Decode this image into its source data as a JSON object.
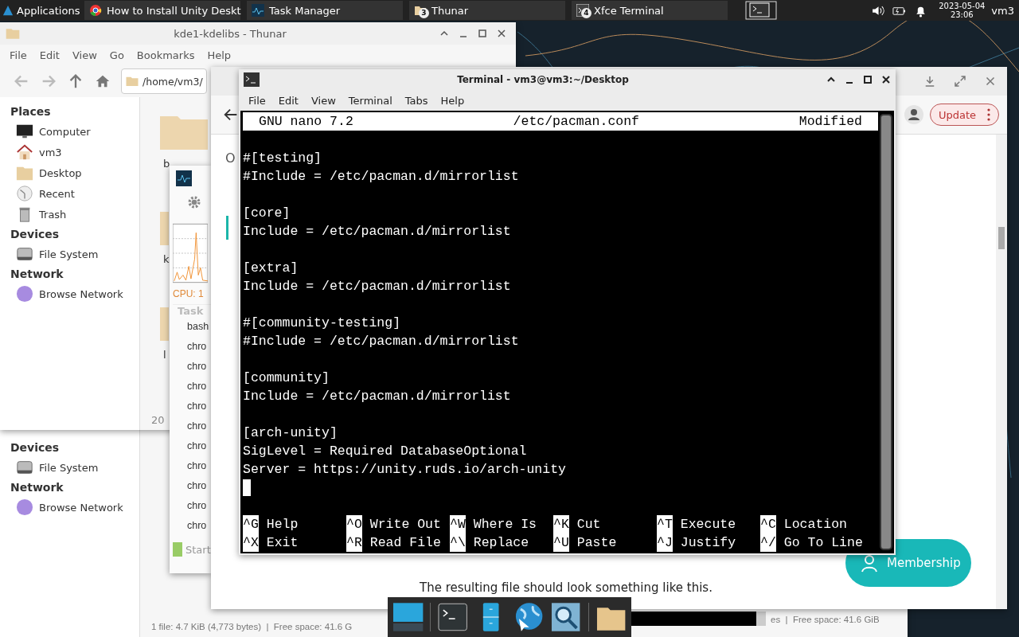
{
  "panel": {
    "apps_label": "Applications",
    "tasks": [
      {
        "kind": "browser",
        "label": "How to Install Unity Deskt"
      },
      {
        "kind": "monitor",
        "label": "Task Manager"
      },
      {
        "kind": "folder",
        "label": "Thunar",
        "badge": "3"
      },
      {
        "kind": "terminal",
        "label": "Xfce Terminal",
        "badge": "4"
      }
    ],
    "date": "2023-05-04",
    "time": "23:06",
    "user": "vm3"
  },
  "thunar_lower": {
    "sidebar": [
      {
        "heading": "Devices",
        "items": [
          {
            "label": "File System"
          }
        ]
      },
      {
        "heading": "Network",
        "items": [
          {
            "label": "Browse Network"
          }
        ]
      }
    ],
    "status": "1 file: 4.7 KiB (4,773 bytes)  |  Free space: 41.6 G"
  },
  "other_status": "es  |  Free space: 41.6 GiB",
  "thunar": {
    "title": "kde1-kdelibs - Thunar",
    "menu": [
      "File",
      "Edit",
      "View",
      "Go",
      "Bookmarks",
      "Help"
    ],
    "path": "/home/vm3/",
    "sidebar": [
      {
        "heading": "Places",
        "items": [
          {
            "label": "Computer"
          },
          {
            "label": "vm3"
          },
          {
            "label": "Desktop"
          },
          {
            "label": "Recent"
          },
          {
            "label": "Trash"
          }
        ]
      },
      {
        "heading": "Devices",
        "items": [
          {
            "label": "File System"
          }
        ]
      },
      {
        "heading": "Network",
        "items": [
          {
            "label": "Browse Network"
          }
        ]
      }
    ],
    "folders": [
      {
        "label": "b"
      },
      {
        "label": "k"
      },
      {
        "label": "l"
      }
    ],
    "status": "20"
  },
  "task_manager": {
    "cpu": "CPU: 1",
    "column": "Task",
    "processes": [
      "bash",
      "chro",
      "chro",
      "chro",
      "chro",
      "chro",
      "chro",
      "chro",
      "chro",
      "chro",
      "chro"
    ],
    "start": "Start"
  },
  "browser": {
    "heading_fragment": "O",
    "update": "Update",
    "membership": "Membership",
    "caption": "The resulting file should look something like this."
  },
  "terminal": {
    "title": "Terminal - vm3@vm3:~/Desktop",
    "menu": [
      "File",
      "Edit",
      "View",
      "Terminal",
      "Tabs",
      "Help"
    ],
    "nano": {
      "version": "GNU nano 7.2",
      "file": "/etc/pacman.conf",
      "status": "Modified",
      "blocks": [
        [
          "#[testing]",
          "#Include = /etc/pacman.d/mirrorlist"
        ],
        [
          "[core]",
          "Include = /etc/pacman.d/mirrorlist"
        ],
        [
          "[extra]",
          "Include = /etc/pacman.d/mirrorlist"
        ],
        [
          "#[community-testing]",
          "#Include = /etc/pacman.d/mirrorlist"
        ],
        [
          "[community]",
          "Include = /etc/pacman.d/mirrorlist"
        ],
        [
          "[arch-unity]",
          "SigLevel = Required DatabaseOptional",
          "Server = https://unity.ruds.io/arch-unity"
        ]
      ],
      "shortcuts": [
        {
          "key": "^G",
          "label": "Help"
        },
        {
          "key": "^O",
          "label": "Write Out"
        },
        {
          "key": "^W",
          "label": "Where Is"
        },
        {
          "key": "^K",
          "label": "Cut"
        },
        {
          "key": "^T",
          "label": "Execute"
        },
        {
          "key": "^C",
          "label": "Location"
        },
        {
          "key": "^X",
          "label": "Exit"
        },
        {
          "key": "^R",
          "label": "Read File"
        },
        {
          "key": "^\\",
          "label": "Replace"
        },
        {
          "key": "^U",
          "label": "Paste"
        },
        {
          "key": "^J",
          "label": "Justify"
        },
        {
          "key": "^/",
          "label": "Go To Line"
        }
      ]
    }
  },
  "dock": {
    "items": [
      {
        "kind": "desktop"
      },
      {
        "kind": "terminal"
      },
      {
        "kind": "cabinet"
      },
      {
        "kind": "globe"
      },
      {
        "kind": "magnifier"
      },
      {
        "kind": "folder"
      }
    ]
  }
}
